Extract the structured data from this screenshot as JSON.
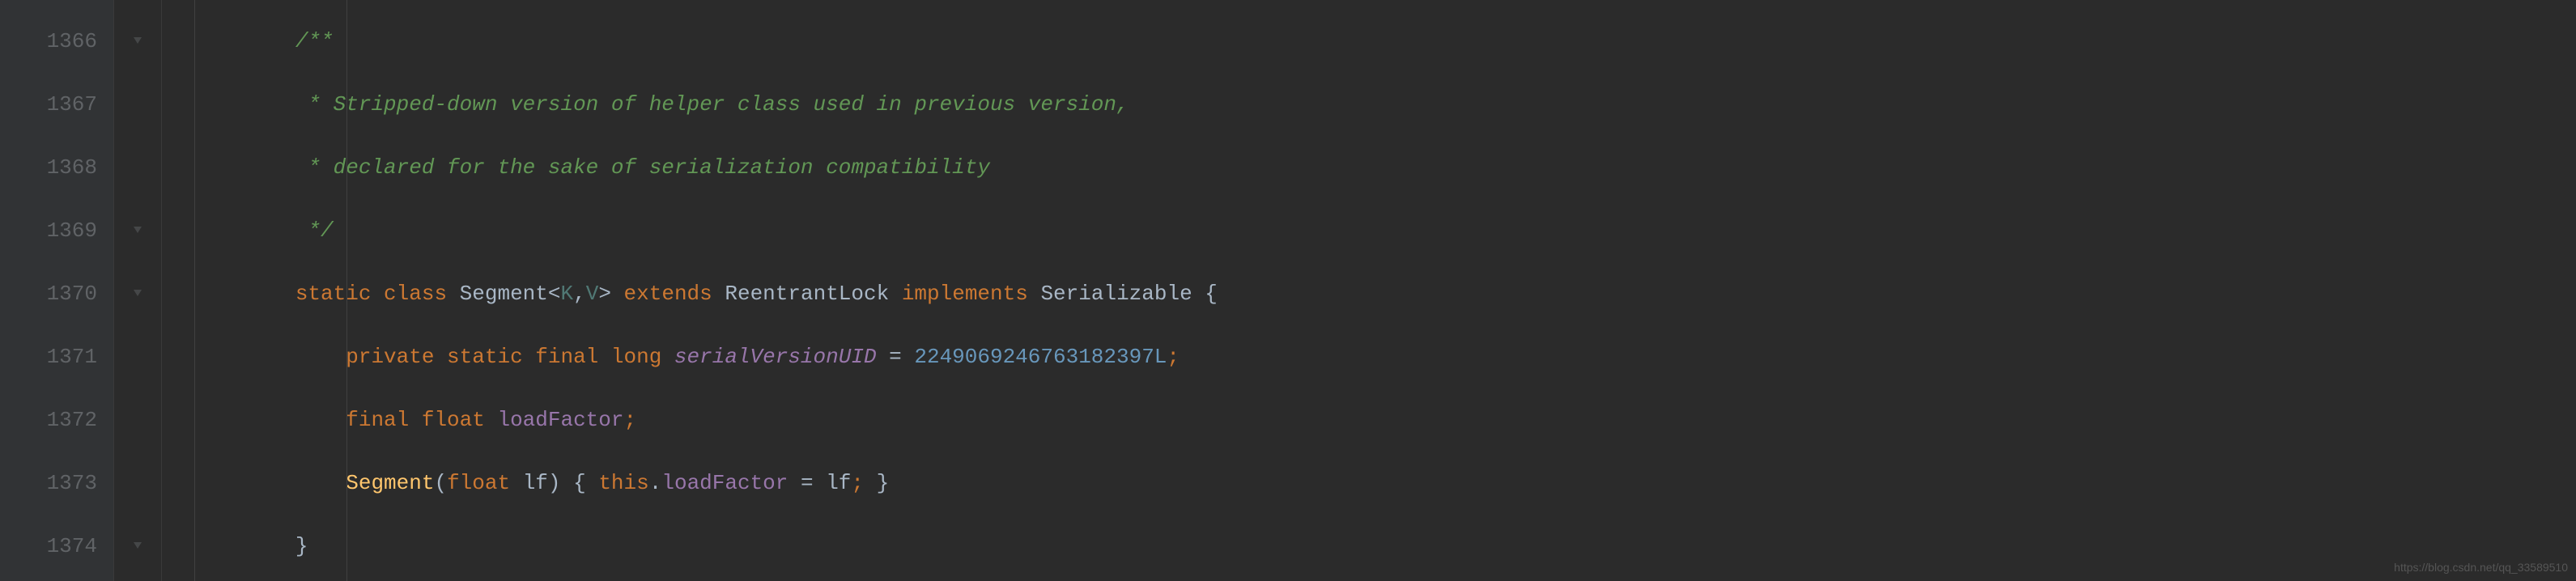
{
  "gutter": {
    "start": 1366,
    "lines": [
      1366,
      1367,
      1368,
      1369,
      1370,
      1371,
      1372,
      1373,
      1374
    ],
    "annotation_line": 1373,
    "annotation_symbol": "@"
  },
  "fold": {
    "marks": [
      "collapse",
      "none",
      "none",
      "collapse",
      "collapse",
      "none",
      "none",
      "none",
      "collapse"
    ]
  },
  "code": {
    "lines": [
      {
        "indent": 2,
        "tokens": [
          {
            "t": "/**",
            "c": "c-comment"
          }
        ]
      },
      {
        "indent": 2,
        "tokens": [
          {
            "t": " * Stripped-down version of helper class used in previous version,",
            "c": "c-comment"
          }
        ]
      },
      {
        "indent": 2,
        "tokens": [
          {
            "t": " * declared for the sake of serialization compatibility",
            "c": "c-comment"
          }
        ]
      },
      {
        "indent": 2,
        "tokens": [
          {
            "t": " */",
            "c": "c-comment"
          }
        ]
      },
      {
        "indent": 2,
        "tokens": [
          {
            "t": "static ",
            "c": "c-keyword"
          },
          {
            "t": "class ",
            "c": "c-keyword"
          },
          {
            "t": "Segment",
            "c": "c-class"
          },
          {
            "t": "<",
            "c": "c-generic"
          },
          {
            "t": "K",
            "c": "c-type"
          },
          {
            "t": ",",
            "c": "c-generic"
          },
          {
            "t": "V",
            "c": "c-type"
          },
          {
            "t": "> ",
            "c": "c-generic"
          },
          {
            "t": "extends ",
            "c": "c-keyword"
          },
          {
            "t": "ReentrantLock ",
            "c": "c-class"
          },
          {
            "t": "implements ",
            "c": "c-keyword"
          },
          {
            "t": "Serializable ",
            "c": "c-class"
          },
          {
            "t": "{",
            "c": "c-parenpunc"
          }
        ]
      },
      {
        "indent": 3,
        "tokens": [
          {
            "t": "private static final long ",
            "c": "c-keyword"
          },
          {
            "t": "serialVersionUID",
            "c": "c-field"
          },
          {
            "t": " = ",
            "c": "c-op"
          },
          {
            "t": "2249069246763182397L",
            "c": "c-number"
          },
          {
            "t": ";",
            "c": "c-semi"
          }
        ]
      },
      {
        "indent": 3,
        "tokens": [
          {
            "t": "final float ",
            "c": "c-keyword"
          },
          {
            "t": "loadFactor",
            "c": "c-fieldref"
          },
          {
            "t": ";",
            "c": "c-semi"
          }
        ]
      },
      {
        "indent": 3,
        "tokens": [
          {
            "t": "Segment",
            "c": "c-method"
          },
          {
            "t": "(",
            "c": "c-parenpunc"
          },
          {
            "t": "float ",
            "c": "c-keyword"
          },
          {
            "t": "lf",
            "c": "c-param"
          },
          {
            "t": ") { ",
            "c": "c-parenpunc"
          },
          {
            "t": "this",
            "c": "c-keyword"
          },
          {
            "t": ".",
            "c": "c-op"
          },
          {
            "t": "loadFactor",
            "c": "c-fieldref"
          },
          {
            "t": " = ",
            "c": "c-op"
          },
          {
            "t": "lf",
            "c": "c-param"
          },
          {
            "t": ";",
            "c": "c-semi"
          },
          {
            "t": " }",
            "c": "c-parenpunc"
          }
        ]
      },
      {
        "indent": 2,
        "tokens": [
          {
            "t": "}",
            "c": "c-parenpunc"
          }
        ]
      }
    ]
  },
  "watermark": "https://blog.csdn.net/qq_33589510",
  "indent_unit": "    "
}
